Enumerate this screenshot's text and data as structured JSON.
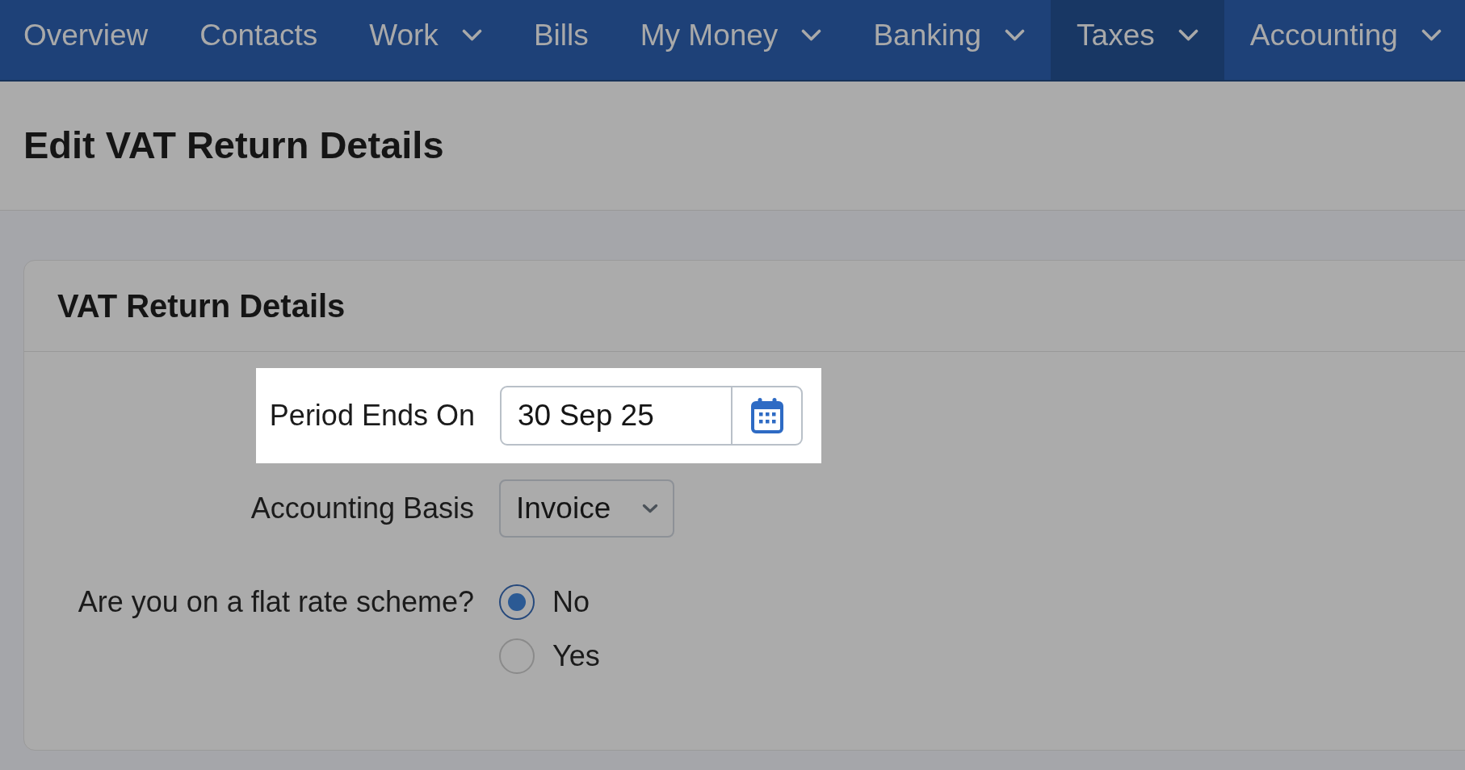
{
  "nav": {
    "items": [
      {
        "label": "Overview",
        "dropdown": false,
        "selected": false
      },
      {
        "label": "Contacts",
        "dropdown": false,
        "selected": false
      },
      {
        "label": "Work",
        "dropdown": true,
        "selected": false
      },
      {
        "label": "Bills",
        "dropdown": false,
        "selected": false
      },
      {
        "label": "My Money",
        "dropdown": true,
        "selected": false
      },
      {
        "label": "Banking",
        "dropdown": true,
        "selected": false
      },
      {
        "label": "Taxes",
        "dropdown": true,
        "selected": true
      },
      {
        "label": "Accounting",
        "dropdown": true,
        "selected": false
      }
    ]
  },
  "page_title": "Edit VAT Return Details",
  "card": {
    "title": "VAT Return Details",
    "fields": [
      {
        "kind": "date",
        "label": "Period Ends On",
        "value": "30 Sep 25",
        "highlighted": true
      },
      {
        "kind": "select",
        "label": "Accounting Basis",
        "value": "Invoice",
        "highlighted": false
      },
      {
        "kind": "radio",
        "label": "Are you on a flat rate scheme?",
        "highlighted": false,
        "options": [
          {
            "label": "No",
            "selected": true
          },
          {
            "label": "Yes",
            "selected": false
          }
        ]
      }
    ]
  }
}
